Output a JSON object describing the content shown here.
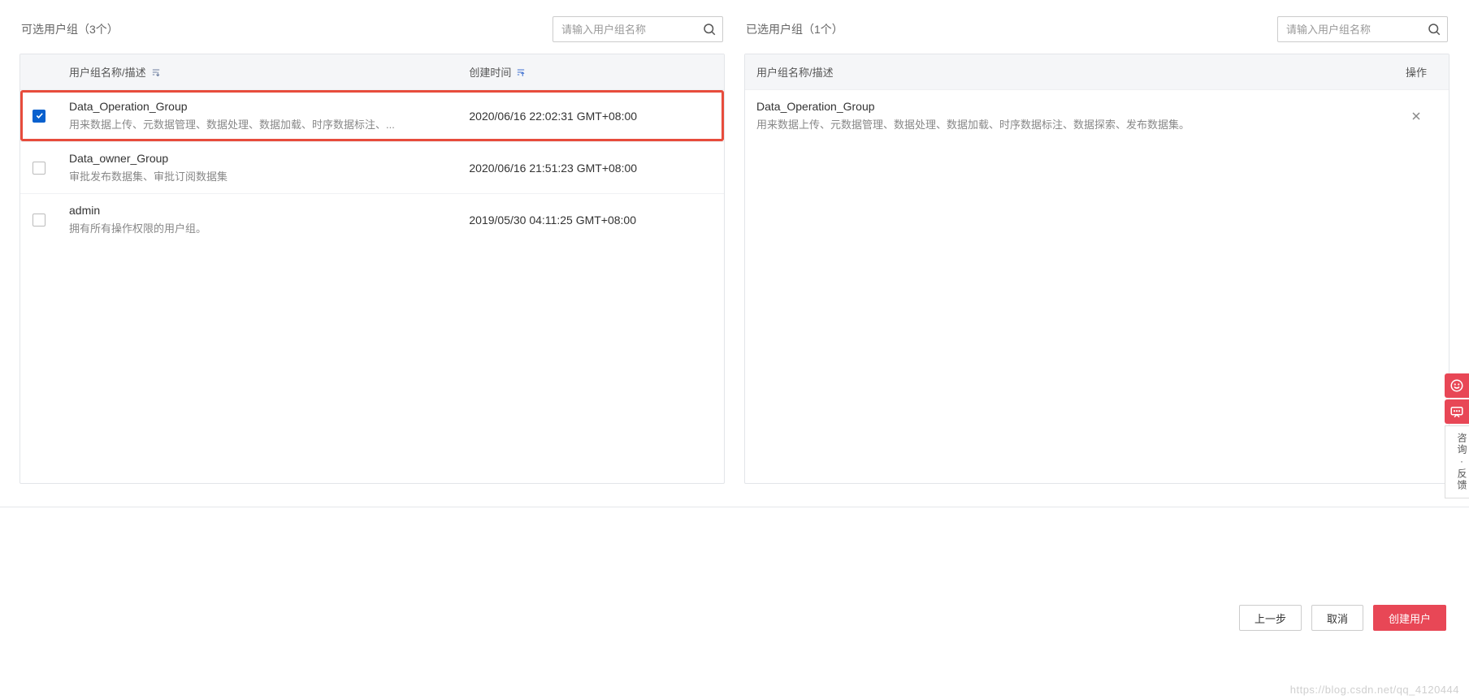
{
  "left": {
    "title": "可选用户组（3个）",
    "search_placeholder": "请输入用户组名称",
    "header_name": "用户组名称/描述",
    "header_time": "创建时间",
    "rows": [
      {
        "checked": true,
        "highlight": true,
        "name": "Data_Operation_Group",
        "desc": "用来数据上传、元数据管理、数据处理、数据加载、时序数据标注、...",
        "time": "2020/06/16 22:02:31 GMT+08:00"
      },
      {
        "checked": false,
        "highlight": false,
        "name": "Data_owner_Group",
        "desc": "审批发布数据集、审批订阅数据集",
        "time": "2020/06/16 21:51:23 GMT+08:00"
      },
      {
        "checked": false,
        "highlight": false,
        "name": "admin",
        "desc": "拥有所有操作权限的用户组。",
        "time": "2019/05/30 04:11:25 GMT+08:00"
      }
    ]
  },
  "right": {
    "title": "已选用户组（1个）",
    "search_placeholder": "请输入用户组名称",
    "header_name": "用户组名称/描述",
    "header_op": "操作",
    "rows": [
      {
        "name": "Data_Operation_Group",
        "desc": "用来数据上传、元数据管理、数据处理、数据加载、时序数据标注、数据探索、发布数据集。"
      }
    ]
  },
  "footer": {
    "prev": "上一步",
    "cancel": "取消",
    "create": "创建用户"
  },
  "side": {
    "feedback_text": "咨询·反馈"
  },
  "watermark": "https://blog.csdn.net/qq_4120444"
}
